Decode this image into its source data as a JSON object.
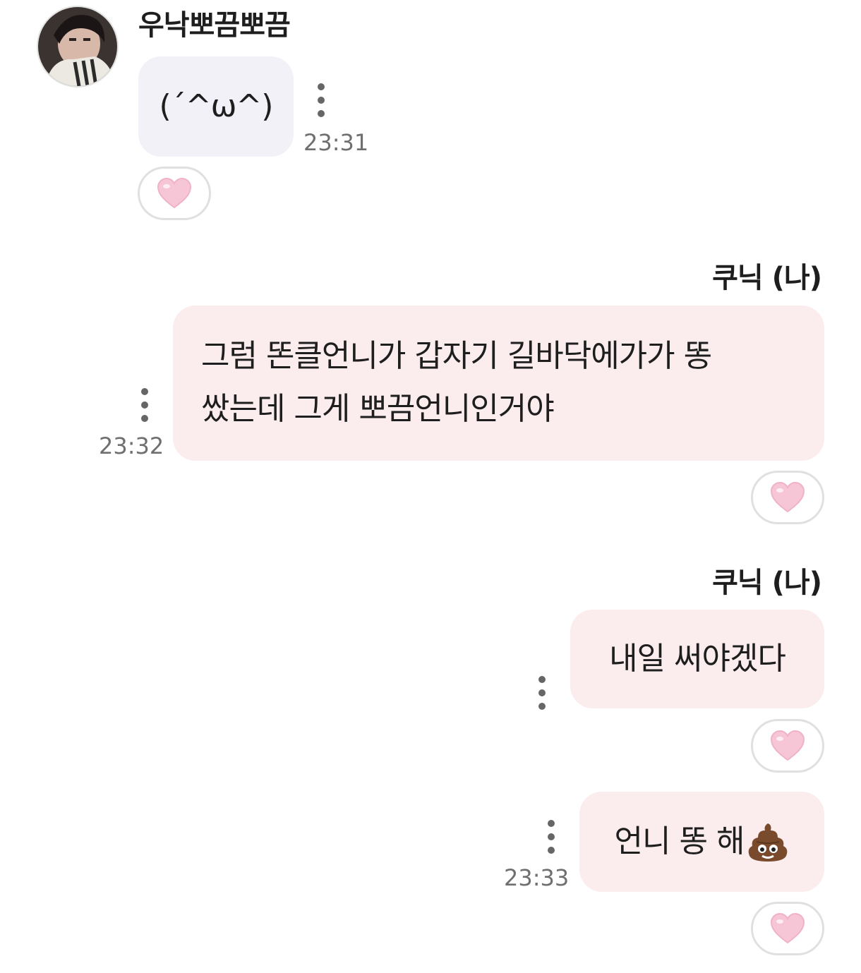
{
  "incoming": {
    "sender_name": "우낙뽀끔뽀끔",
    "message": "(´^ω^)",
    "time": "23:31"
  },
  "outgoing_group_1": {
    "sender_name": "쿠닉 (나)",
    "message_line_1": "그럼 똔클언니가 갑자기 길바닥에가가 똥",
    "message_line_2": "쌌는데 그게 뽀끔언니인거야",
    "time": "23:32"
  },
  "outgoing_group_2": {
    "sender_name": "쿠닉 (나)",
    "message_1": "내일 써야겠다",
    "message_2": "언니 똥 해",
    "message_2_emoji": "poop-emoji",
    "time": "23:33"
  },
  "icons": {
    "reaction": "heart-icon",
    "more": "kebab-menu-icon"
  },
  "colors": {
    "incoming_bubble": "#f1f1f7",
    "outgoing_bubble": "#fbecee",
    "heart": "#f7c6d6"
  }
}
